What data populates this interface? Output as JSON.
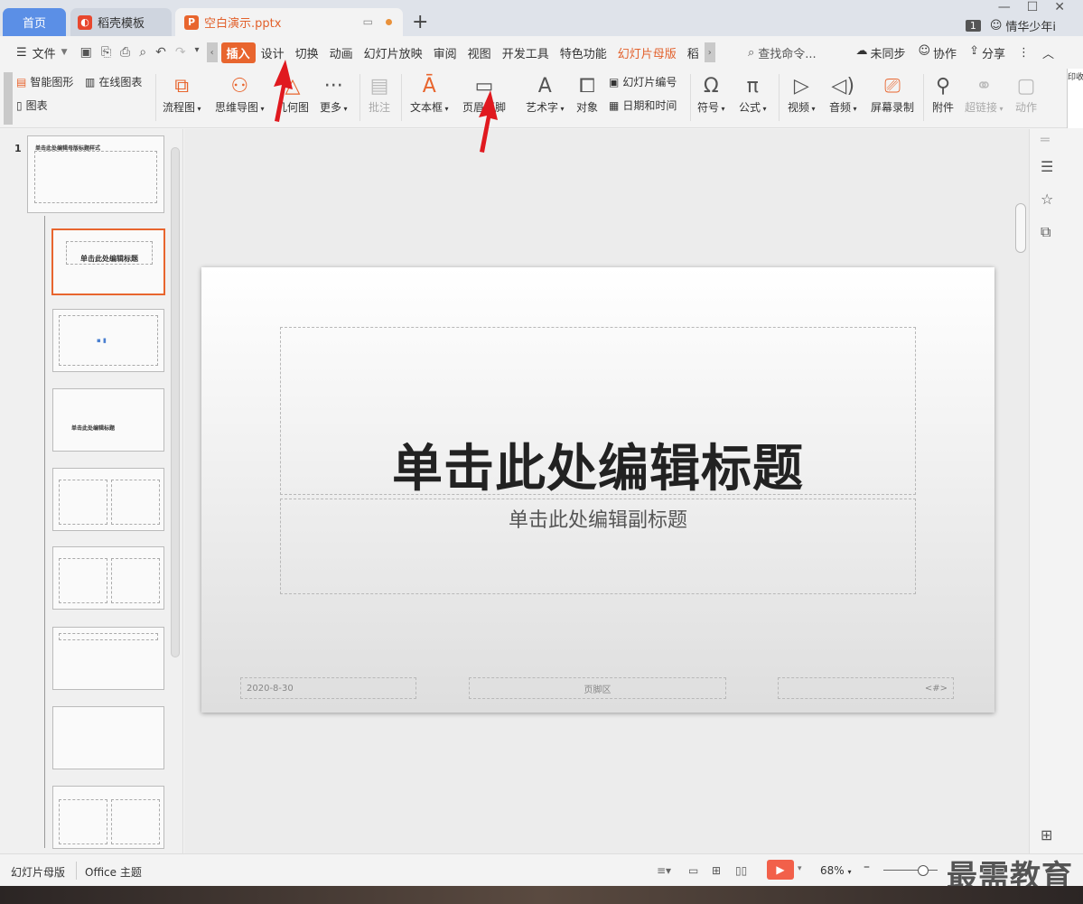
{
  "tabs": {
    "home": "首页",
    "template": "稻壳模板",
    "doc": "空白演示.pptx"
  },
  "titlebar": {
    "badge": "1",
    "user": "情华少年i",
    "corner_text": "印收藏"
  },
  "menu": {
    "file": "文件",
    "items": [
      "插入",
      "设计",
      "切换",
      "动画",
      "幻灯片放映",
      "审阅",
      "视图",
      "开发工具",
      "特色功能",
      "幻灯片母版",
      "稻"
    ],
    "search": "查找命令...",
    "sync": "未同步",
    "collab": "协作",
    "share": "分享"
  },
  "ribbon": {
    "smart_shape": "智能图形",
    "online_chart": "在线图表",
    "chart": "图表",
    "flowchart": "流程图",
    "mindmap": "思维导图",
    "geometry": "几何图",
    "more": "更多",
    "comment": "批注",
    "textbox": "文本框",
    "header_footer": "页眉页脚",
    "wordart": "艺术字",
    "object": "对象",
    "slide_number": "幻灯片编号",
    "datetime": "日期和时间",
    "symbol": "符号",
    "formula": "公式",
    "video": "视频",
    "audio": "音频",
    "screen_record": "屏幕录制",
    "attachment": "附件",
    "hyperlink": "超链接",
    "action": "动作"
  },
  "panel": {
    "slide_number": "1",
    "master_title": "单击此处编辑母版标题样式",
    "layout_title": "单击此处编辑标题",
    "layout_title_small": "单击此处编辑标题"
  },
  "slide": {
    "title": "单击此处编辑标题",
    "subtitle": "单击此处编辑副标题",
    "footer_date": "2020-8-30",
    "footer_center": "页脚区",
    "footer_num": "<#>"
  },
  "status": {
    "mode": "幻灯片母版",
    "theme": "Office 主题",
    "zoom": "68%"
  },
  "watermark": "最需教育",
  "colors": {
    "accent": "#e8652e",
    "home_tab": "#5b8fe6",
    "play": "#f2604a",
    "arrow": "#e0191f"
  }
}
